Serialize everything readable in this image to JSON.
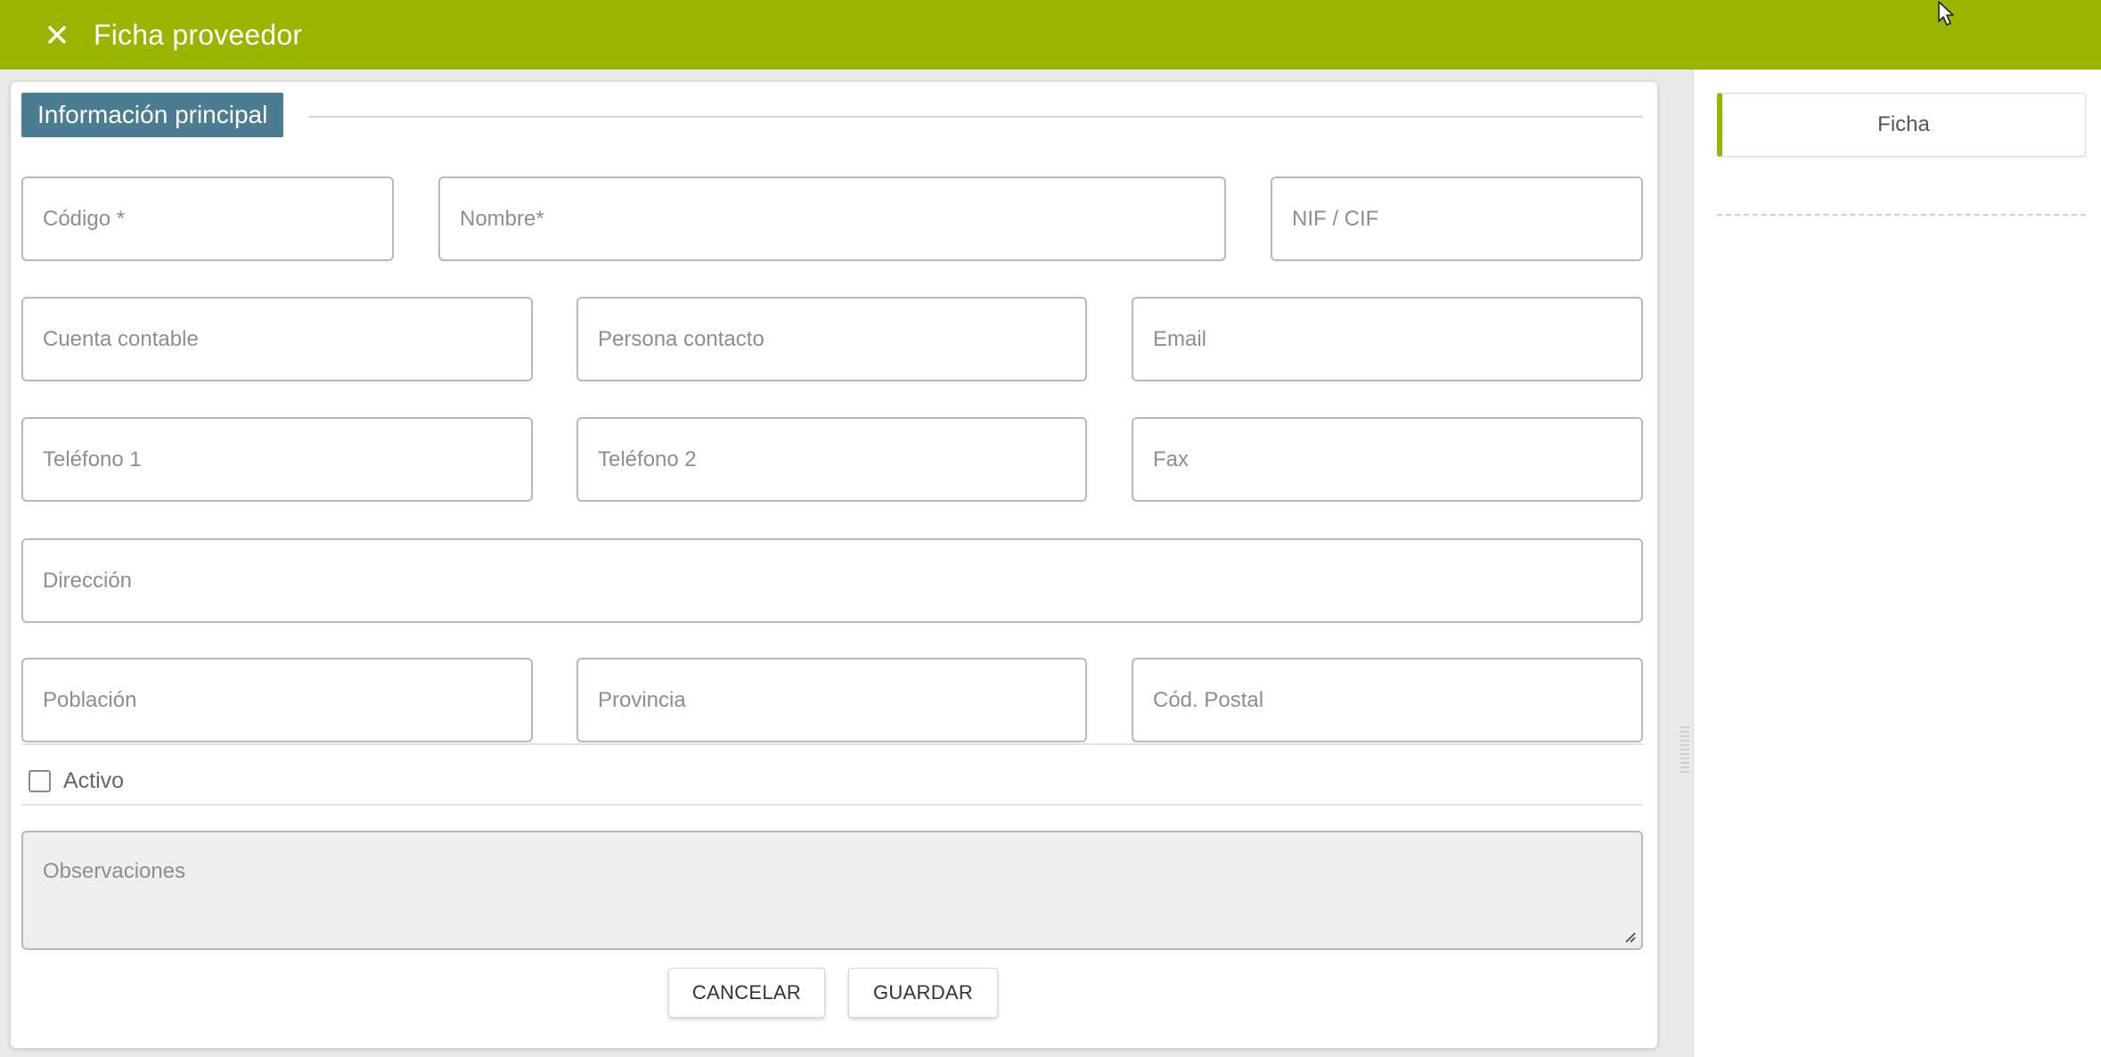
{
  "window": {
    "title": "Ficha proveedor",
    "accent_color": "#9ab400",
    "close_icon": "close-icon"
  },
  "form": {
    "section_title": "Información principal",
    "section_color": "#4a7d92",
    "fields": {
      "codigo": "Código *",
      "nombre": "Nombre*",
      "nif": "NIF / CIF",
      "cuenta": "Cuenta contable",
      "persona": "Persona contacto",
      "email": "Email",
      "telefono1": "Teléfono 1",
      "telefono2": "Teléfono 2",
      "fax": "Fax",
      "direccion": "Dirección",
      "poblacion": "Población",
      "provincia": "Provincia",
      "cod_postal": "Cód. Postal"
    },
    "activo_label": "Activo",
    "activo_checked": false,
    "observaciones": "Observaciones",
    "cancel_label": "CANCELAR",
    "save_label": "GUARDAR"
  },
  "sidebar": {
    "tabs": [
      {
        "label": "Ficha",
        "active": true
      }
    ]
  }
}
